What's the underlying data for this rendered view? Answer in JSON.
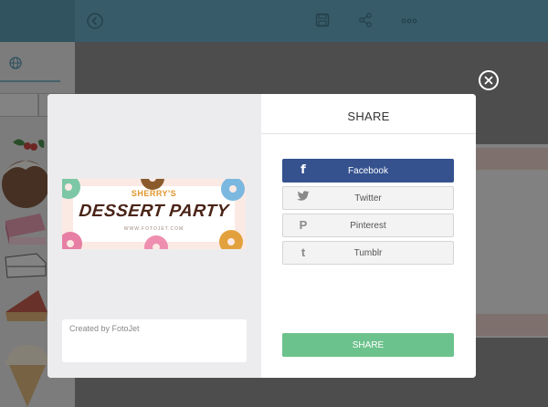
{
  "modal": {
    "title": "SHARE",
    "caption": "Created by FotoJet",
    "share_button": "SHARE",
    "buttons": [
      {
        "label": "Facebook",
        "icon": "facebook-icon",
        "glyph": "f"
      },
      {
        "label": "Twitter",
        "icon": "twitter-icon",
        "glyph": ""
      },
      {
        "label": "Pinterest",
        "icon": "pinterest-icon",
        "glyph": "P"
      },
      {
        "label": "Tumblr",
        "icon": "tumblr-icon",
        "glyph": "t"
      }
    ]
  },
  "preview": {
    "subtitle": "SHERRY'S",
    "title": "DESSERT PARTY",
    "url": "WWW.FOTOJET.COM"
  },
  "toolbar": {
    "icons": [
      "back-icon",
      "save-icon",
      "share-icon",
      "more-icon"
    ]
  },
  "colors": {
    "facebook": "#35528f",
    "share_green": "#6cc28c",
    "topbar": "#4a99b7"
  }
}
